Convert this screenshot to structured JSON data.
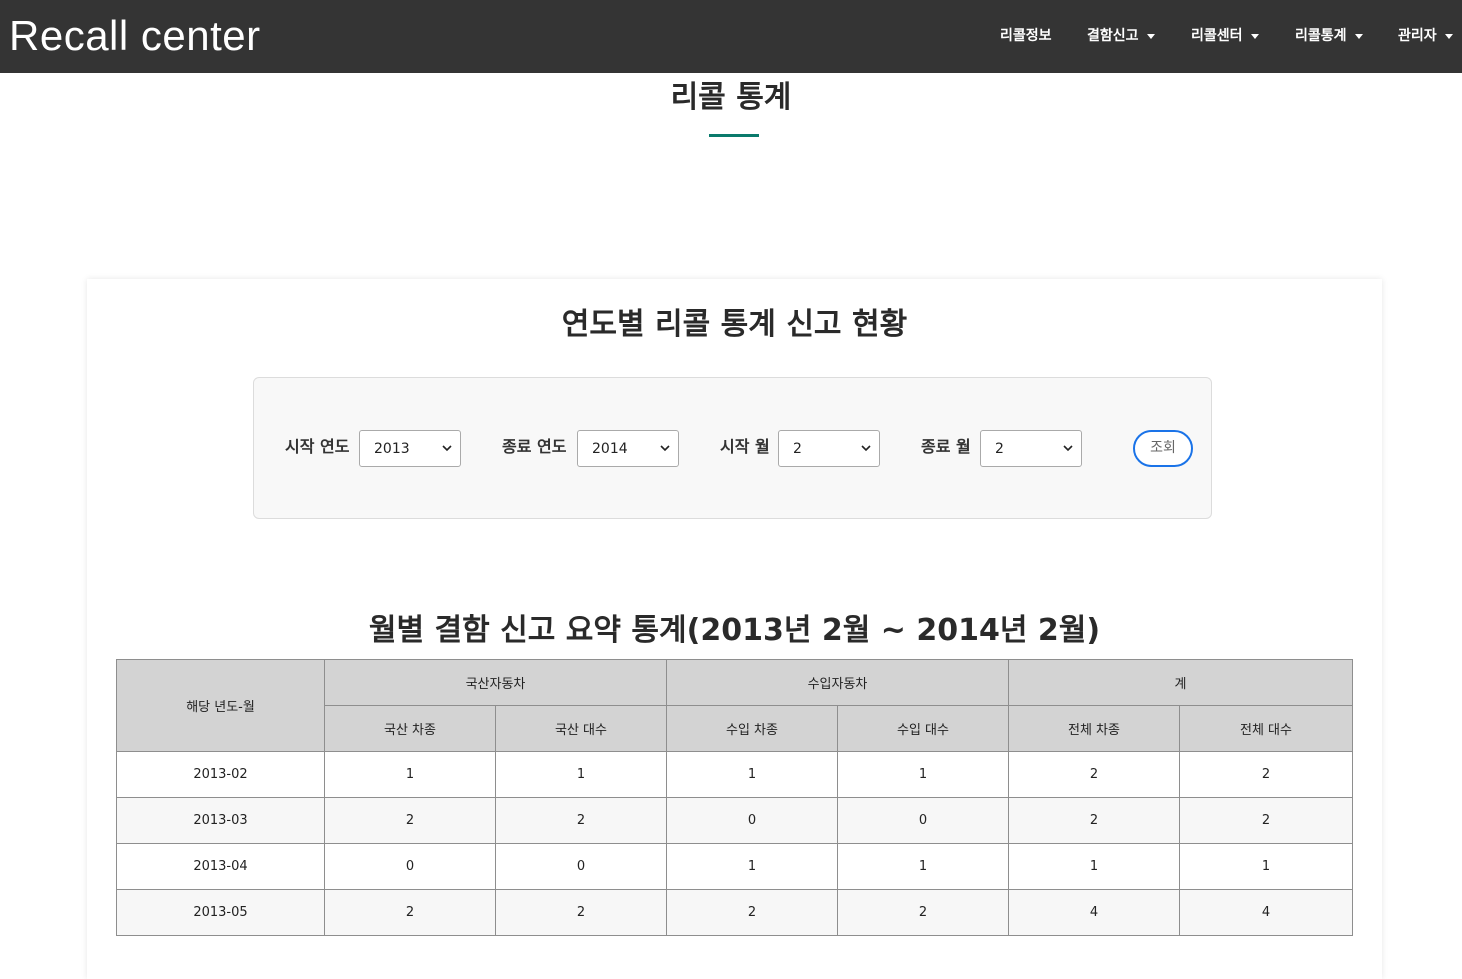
{
  "navbar": {
    "brand": "Recall center",
    "items": [
      {
        "label": "리콜정보",
        "dropdown": false
      },
      {
        "label": "결함신고",
        "dropdown": true
      },
      {
        "label": "리콜센터",
        "dropdown": true
      },
      {
        "label": "리콜통계",
        "dropdown": true
      },
      {
        "label": "관리자",
        "dropdown": true
      }
    ]
  },
  "page": {
    "heading": "리콜 통계",
    "accent_color": "#0a7a6c"
  },
  "card": {
    "title": "연도별 리콜 통계 신고 현황",
    "filters": {
      "start_year": {
        "label": "시작 연도",
        "value": "2013"
      },
      "end_year": {
        "label": "종료 연도",
        "value": "2014"
      },
      "start_month": {
        "label": "시작 월",
        "value": "2"
      },
      "end_month": {
        "label": "종료 월",
        "value": "2"
      },
      "query_button": "조회"
    },
    "table_title": "월별 결함 신고 요약 통계(2013년 2월 ~ 2014년 2월)"
  },
  "table": {
    "head_period": "해당 년도-월",
    "groups": [
      "국산자동차",
      "수입자동차",
      "계"
    ],
    "subheads": [
      "국산 차종",
      "국산 대수",
      "수입 차종",
      "수입 대수",
      "전체 차종",
      "전체 대수"
    ],
    "rows": [
      [
        "2013-02",
        "1",
        "1",
        "1",
        "1",
        "2",
        "2"
      ],
      [
        "2013-03",
        "2",
        "2",
        "0",
        "0",
        "2",
        "2"
      ],
      [
        "2013-04",
        "0",
        "0",
        "1",
        "1",
        "1",
        "1"
      ],
      [
        "2013-05",
        "2",
        "2",
        "2",
        "2",
        "4",
        "4"
      ]
    ]
  }
}
